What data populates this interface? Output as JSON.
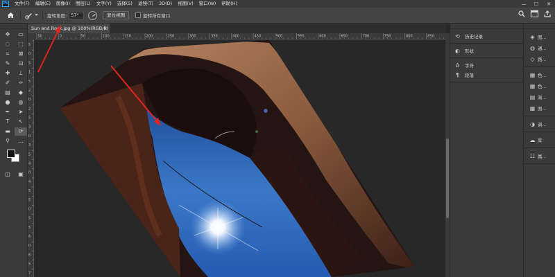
{
  "app": {
    "logo": "Ps"
  },
  "menubar": {
    "items": [
      "文件(F)",
      "编辑(E)",
      "图像(I)",
      "图层(L)",
      "文字(Y)",
      "选择(S)",
      "滤镜(T)",
      "3D(D)",
      "视图(V)",
      "窗口(W)",
      "帮助(H)"
    ]
  },
  "window_controls": {
    "minimize": "—",
    "maximize": "☐",
    "close": "✕"
  },
  "options": {
    "angle_label": "旋转角度:",
    "angle_value": "57°",
    "reset_label": "复位视图",
    "rotate_all_label": "旋转所有窗口"
  },
  "document": {
    "tab_title": "Sun and Rock.jpg @ 100%(RGB/8) *",
    "close_glyph": "×"
  },
  "ruler": {
    "h_marks": [
      "50",
      "0",
      "50",
      "100",
      "150",
      "200",
      "250",
      "300",
      "350",
      "400",
      "450",
      "500",
      "550",
      "600",
      "650",
      "700",
      "750",
      "800",
      "850"
    ],
    "v_marks": [
      "5",
      "0",
      "5",
      "1",
      "5",
      "2",
      "0",
      "2",
      "5",
      "3",
      "0",
      "3",
      "5",
      "4",
      "0",
      "4",
      "5",
      "5",
      "0",
      "5",
      "5",
      "6",
      "0",
      "6",
      "5",
      "7"
    ]
  },
  "panels": {
    "mid": [
      {
        "icon": "history-icon",
        "glyph": "⟲",
        "label": "历史记录"
      },
      {
        "icon": "shapes-icon",
        "glyph": "◐",
        "label": "形状"
      },
      {
        "icon": "character-icon",
        "glyph": "A",
        "label": "字符"
      },
      {
        "icon": "paragraph-icon",
        "glyph": "¶",
        "label": "段落"
      }
    ],
    "right": [
      {
        "icon": "layers-icon",
        "glyph": "◈",
        "label": "图..."
      },
      {
        "icon": "channels-icon",
        "glyph": "◍",
        "label": "通..."
      },
      {
        "icon": "paths-icon",
        "glyph": "◇",
        "label": "路..."
      },
      {
        "icon": "color-icon",
        "glyph": "▦",
        "label": "色..."
      },
      {
        "icon": "swatches-icon",
        "glyph": "▦",
        "label": "色..."
      },
      {
        "icon": "gradients-icon",
        "glyph": "▤",
        "label": "渐..."
      },
      {
        "icon": "patterns-icon",
        "glyph": "▦",
        "label": "图..."
      },
      {
        "icon": "adjustments-icon",
        "glyph": "◑",
        "label": "调..."
      },
      {
        "icon": "libraries-icon",
        "glyph": "☁",
        "label": "库"
      },
      {
        "icon": "properties-icon",
        "glyph": "☷",
        "label": "属..."
      }
    ]
  }
}
